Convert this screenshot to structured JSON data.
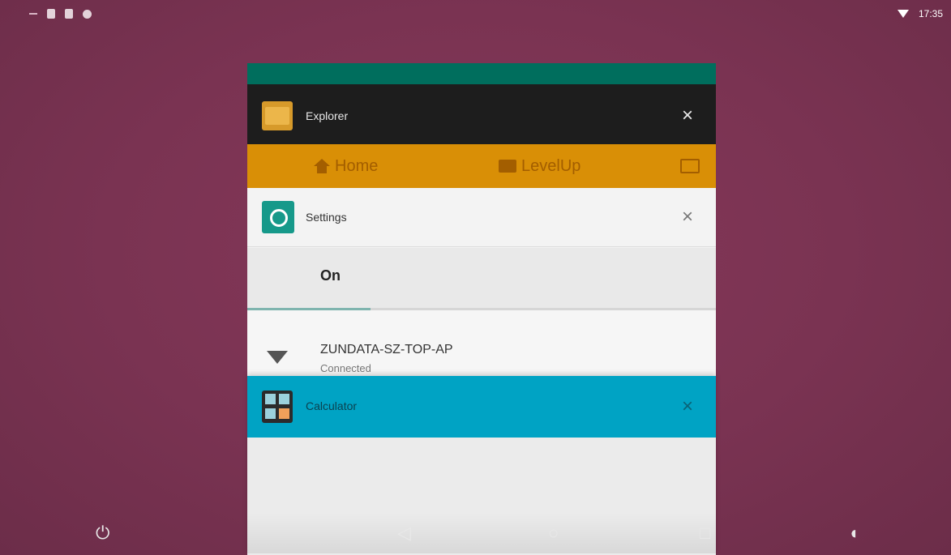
{
  "status_bar": {
    "time": "17:35",
    "left_icons": [
      "notification-dash",
      "sd-card-icon",
      "android-icon",
      "android-debug-icon"
    ],
    "right_icons": [
      "wifi-icon"
    ]
  },
  "recents": {
    "explorer": {
      "title": "Explorer",
      "close_label": "×",
      "tabs": [
        {
          "label": "Home",
          "icon": "house-icon"
        },
        {
          "label": "LevelUp",
          "icon": "box-icon"
        }
      ]
    },
    "settings": {
      "title": "Settings",
      "close_label": "×",
      "switch_label": "On",
      "network": {
        "name": "ZUNDATA-SZ-TOP-AP",
        "status": "Connected"
      }
    },
    "calculator": {
      "title": "Calculator",
      "close_label": "×"
    }
  },
  "nav_bar": {
    "power_glyph": "⏻",
    "back_glyph": "◁",
    "home_glyph": "○",
    "recents_glyph": "□",
    "volume_glyph": "◖"
  },
  "colors": {
    "wallpaper": "#7a3352",
    "explorer_accent": "#d98f06",
    "settings_accent": "#16998a",
    "calculator_accent": "#00a3c4"
  }
}
